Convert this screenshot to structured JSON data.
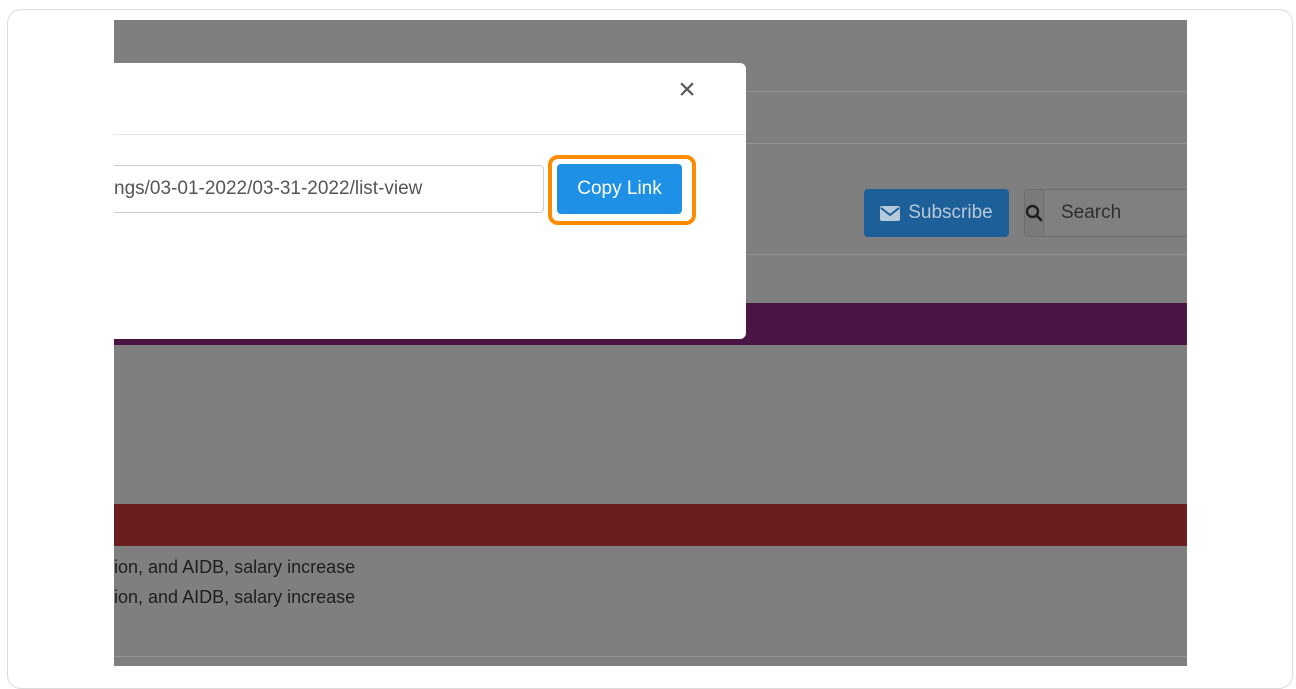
{
  "modal": {
    "close_glyph": "×",
    "link_value": "ngs/03-01-2022/03-31-2022/list-view",
    "copy_button_label": "Copy Link"
  },
  "header": {
    "subscribe_label": "Subscribe",
    "search_placeholder": "Search"
  },
  "list": {
    "items": [
      "ion, and AIDB, salary increase",
      "ion, and AIDB, salary increase"
    ]
  },
  "colors": {
    "overlay": "#7f7f7f",
    "purple_banner": "#4a1545",
    "red_banner": "#6b1e1e",
    "copy_button": "#1e90e6",
    "highlight_outline": "#ff8c00"
  },
  "icons": {
    "close": "close-icon",
    "envelope": "envelope-icon",
    "search": "search-icon"
  }
}
